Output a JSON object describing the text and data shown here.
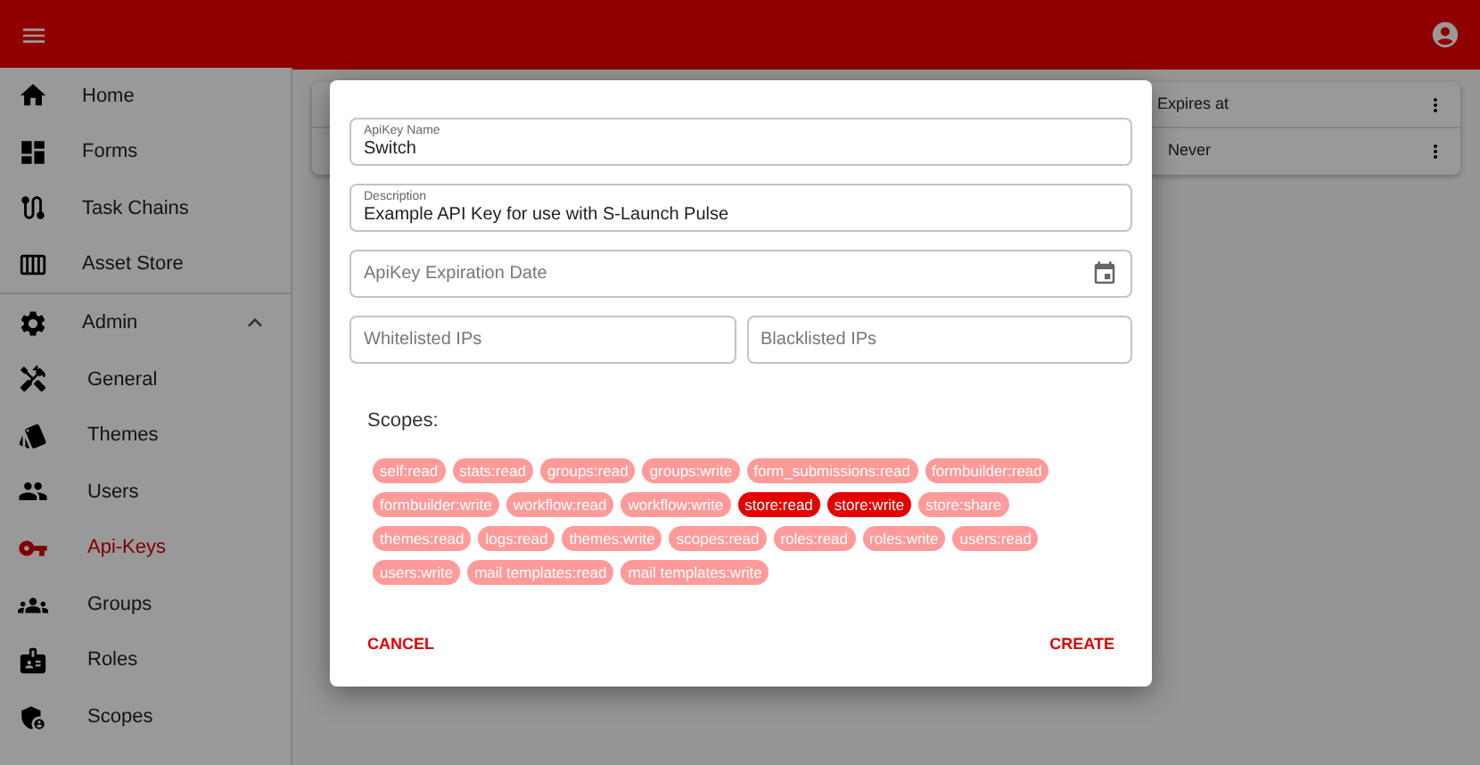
{
  "sidebar": {
    "items": [
      {
        "label": "Home",
        "selected": false
      },
      {
        "label": "Forms",
        "selected": false
      },
      {
        "label": "Task Chains",
        "selected": false
      },
      {
        "label": "Asset Store",
        "selected": false
      },
      {
        "label": "Admin",
        "selected": false,
        "expanded": true,
        "children": [
          {
            "label": "General",
            "selected": false
          },
          {
            "label": "Themes",
            "selected": false
          },
          {
            "label": "Users",
            "selected": false
          },
          {
            "label": "Api-Keys",
            "selected": true
          },
          {
            "label": "Groups",
            "selected": false
          },
          {
            "label": "Roles",
            "selected": false
          },
          {
            "label": "Scopes",
            "selected": false
          }
        ]
      }
    ]
  },
  "table": {
    "columns": [
      "Expires at"
    ],
    "rows": [
      [
        "Never"
      ]
    ]
  },
  "dialog": {
    "fields": [
      {
        "label": "ApiKey Name",
        "value": "Switch"
      },
      {
        "label": "Description",
        "value": "Example API Key for use with S-Launch Pulse"
      },
      {
        "placeholder": "ApiKey Expiration Date",
        "kind": "date"
      }
    ],
    "ip_fields": [
      {
        "placeholder": "Whitelisted IPs"
      },
      {
        "placeholder": "Blacklisted IPs"
      }
    ],
    "scopes_label": "Scopes:",
    "scopes": [
      {
        "label": "self:read",
        "selected": false
      },
      {
        "label": "stats:read",
        "selected": false
      },
      {
        "label": "groups:read",
        "selected": false
      },
      {
        "label": "groups:write",
        "selected": false
      },
      {
        "label": "form_submissions:read",
        "selected": false
      },
      {
        "label": "formbuilder:read",
        "selected": false
      },
      {
        "label": "formbuilder:write",
        "selected": false
      },
      {
        "label": "workflow:read",
        "selected": false
      },
      {
        "label": "workflow:write",
        "selected": false
      },
      {
        "label": "store:read",
        "selected": true
      },
      {
        "label": "store:write",
        "selected": true
      },
      {
        "label": "store:share",
        "selected": false
      },
      {
        "label": "themes:read",
        "selected": false
      },
      {
        "label": "logs:read",
        "selected": false
      },
      {
        "label": "themes:write",
        "selected": false
      },
      {
        "label": "scopes:read",
        "selected": false
      },
      {
        "label": "roles:read",
        "selected": false
      },
      {
        "label": "roles:write",
        "selected": false
      },
      {
        "label": "users:read",
        "selected": false
      },
      {
        "label": "users:write",
        "selected": false
      },
      {
        "label": "mail templates:read",
        "selected": false
      },
      {
        "label": "mail templates:write",
        "selected": false
      }
    ],
    "buttons": [
      "CANCEL",
      "CREATE"
    ]
  }
}
